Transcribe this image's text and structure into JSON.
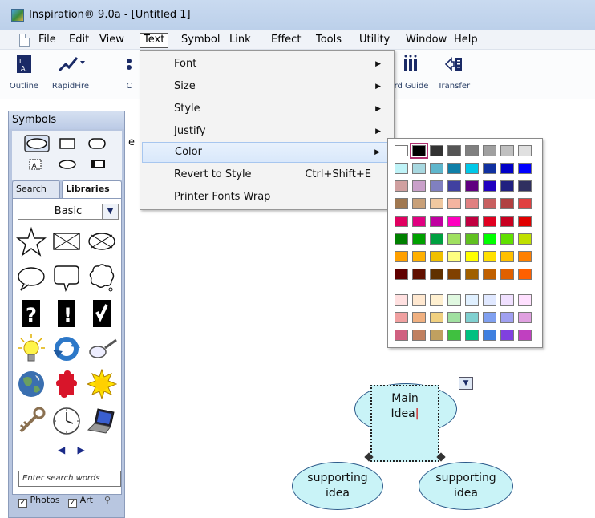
{
  "window": {
    "title": "Inspiration® 9.0a - [Untitled 1]"
  },
  "menubar": [
    "File",
    "Edit",
    "View",
    "Text",
    "Symbol",
    "Link",
    "Effect",
    "Tools",
    "Utility",
    "Window",
    "Help"
  ],
  "toolbar": {
    "outline": "Outline",
    "rapidfire": "RapidFire",
    "c": "C",
    "wordguide": "rd Guide",
    "transfer": "Transfer"
  },
  "palette": {
    "title": "Symbols",
    "tabs": {
      "search": "Search",
      "libraries": "Libraries"
    },
    "library": "Basic",
    "search_placeholder": "Enter search words",
    "photos": "Photos",
    "art": "Art"
  },
  "text_menu": {
    "items": [
      {
        "label": "Font",
        "submenu": true
      },
      {
        "label": "Size",
        "submenu": true
      },
      {
        "label": "Style",
        "submenu": true
      },
      {
        "label": "Justify",
        "submenu": true
      },
      {
        "label": "Color",
        "submenu": true,
        "highlighted": true
      },
      {
        "label": "Revert to Style",
        "shortcut": "Ctrl+Shift+E"
      },
      {
        "label": "Printer Fonts Wrap"
      }
    ]
  },
  "color_palette": {
    "selected": "#000000",
    "rows": [
      [
        "#ffffff",
        "#000000",
        "#333333",
        "#555555",
        "#808080",
        "#a0a0a0",
        "#c0c0c0",
        "#e0e0e0"
      ],
      [
        "#bff3f7",
        "#a8d8e0",
        "#5fb6cc",
        "#0f7fa8",
        "#00c8e8",
        "#1030a0",
        "#0000c8",
        "#0000ff"
      ],
      [
        "#d0a0a0",
        "#c9a0c9",
        "#8080c0",
        "#4040a0",
        "#600080",
        "#2000c0",
        "#202080",
        "#303060"
      ],
      [
        "#a07850",
        "#c8a078",
        "#f0c8a0",
        "#f4b4a0",
        "#e08080",
        "#c86060",
        "#b04040",
        "#e04040"
      ],
      [
        "#e00060",
        "#e00080",
        "#c000a0",
        "#ff00c0",
        "#c00040",
        "#e00020",
        "#c80020",
        "#e00000"
      ],
      [
        "#008000",
        "#00a000",
        "#00a040",
        "#a0e060",
        "#60c020",
        "#00ff00",
        "#60e000",
        "#c0e000"
      ],
      [
        "#ffa000",
        "#ffb000",
        "#f0c000",
        "#ffff80",
        "#ffff00",
        "#ffe000",
        "#ffc000",
        "#ff8000"
      ],
      [
        "#600000",
        "#601000",
        "#603000",
        "#804000",
        "#a06000",
        "#c06000",
        "#e06000",
        "#ff6000"
      ],
      [
        "#ffe0e0",
        "#ffe8d0",
        "#fff0d0",
        "#e0f8e0",
        "#e0f0ff",
        "#e0e8ff",
        "#f0e0ff",
        "#ffe0ff"
      ],
      [
        "#f0a0a0",
        "#f0b080",
        "#f0d080",
        "#a0e0a0",
        "#80d0d0",
        "#80a0f0",
        "#a0a0f0",
        "#e0a0e0"
      ],
      [
        "#d06080",
        "#c08060",
        "#c0a060",
        "#40c040",
        "#00c080",
        "#4080e0",
        "#8040e0",
        "#c040c0"
      ]
    ]
  },
  "diagram": {
    "main_idea": [
      "Main",
      "Idea"
    ],
    "supporting_left": [
      "supporting",
      "idea"
    ],
    "supporting_right": [
      "supporting",
      "idea"
    ]
  },
  "accent_colors": {
    "node_fill": "#c9f3f7",
    "node_border": "#2c5a8a"
  }
}
